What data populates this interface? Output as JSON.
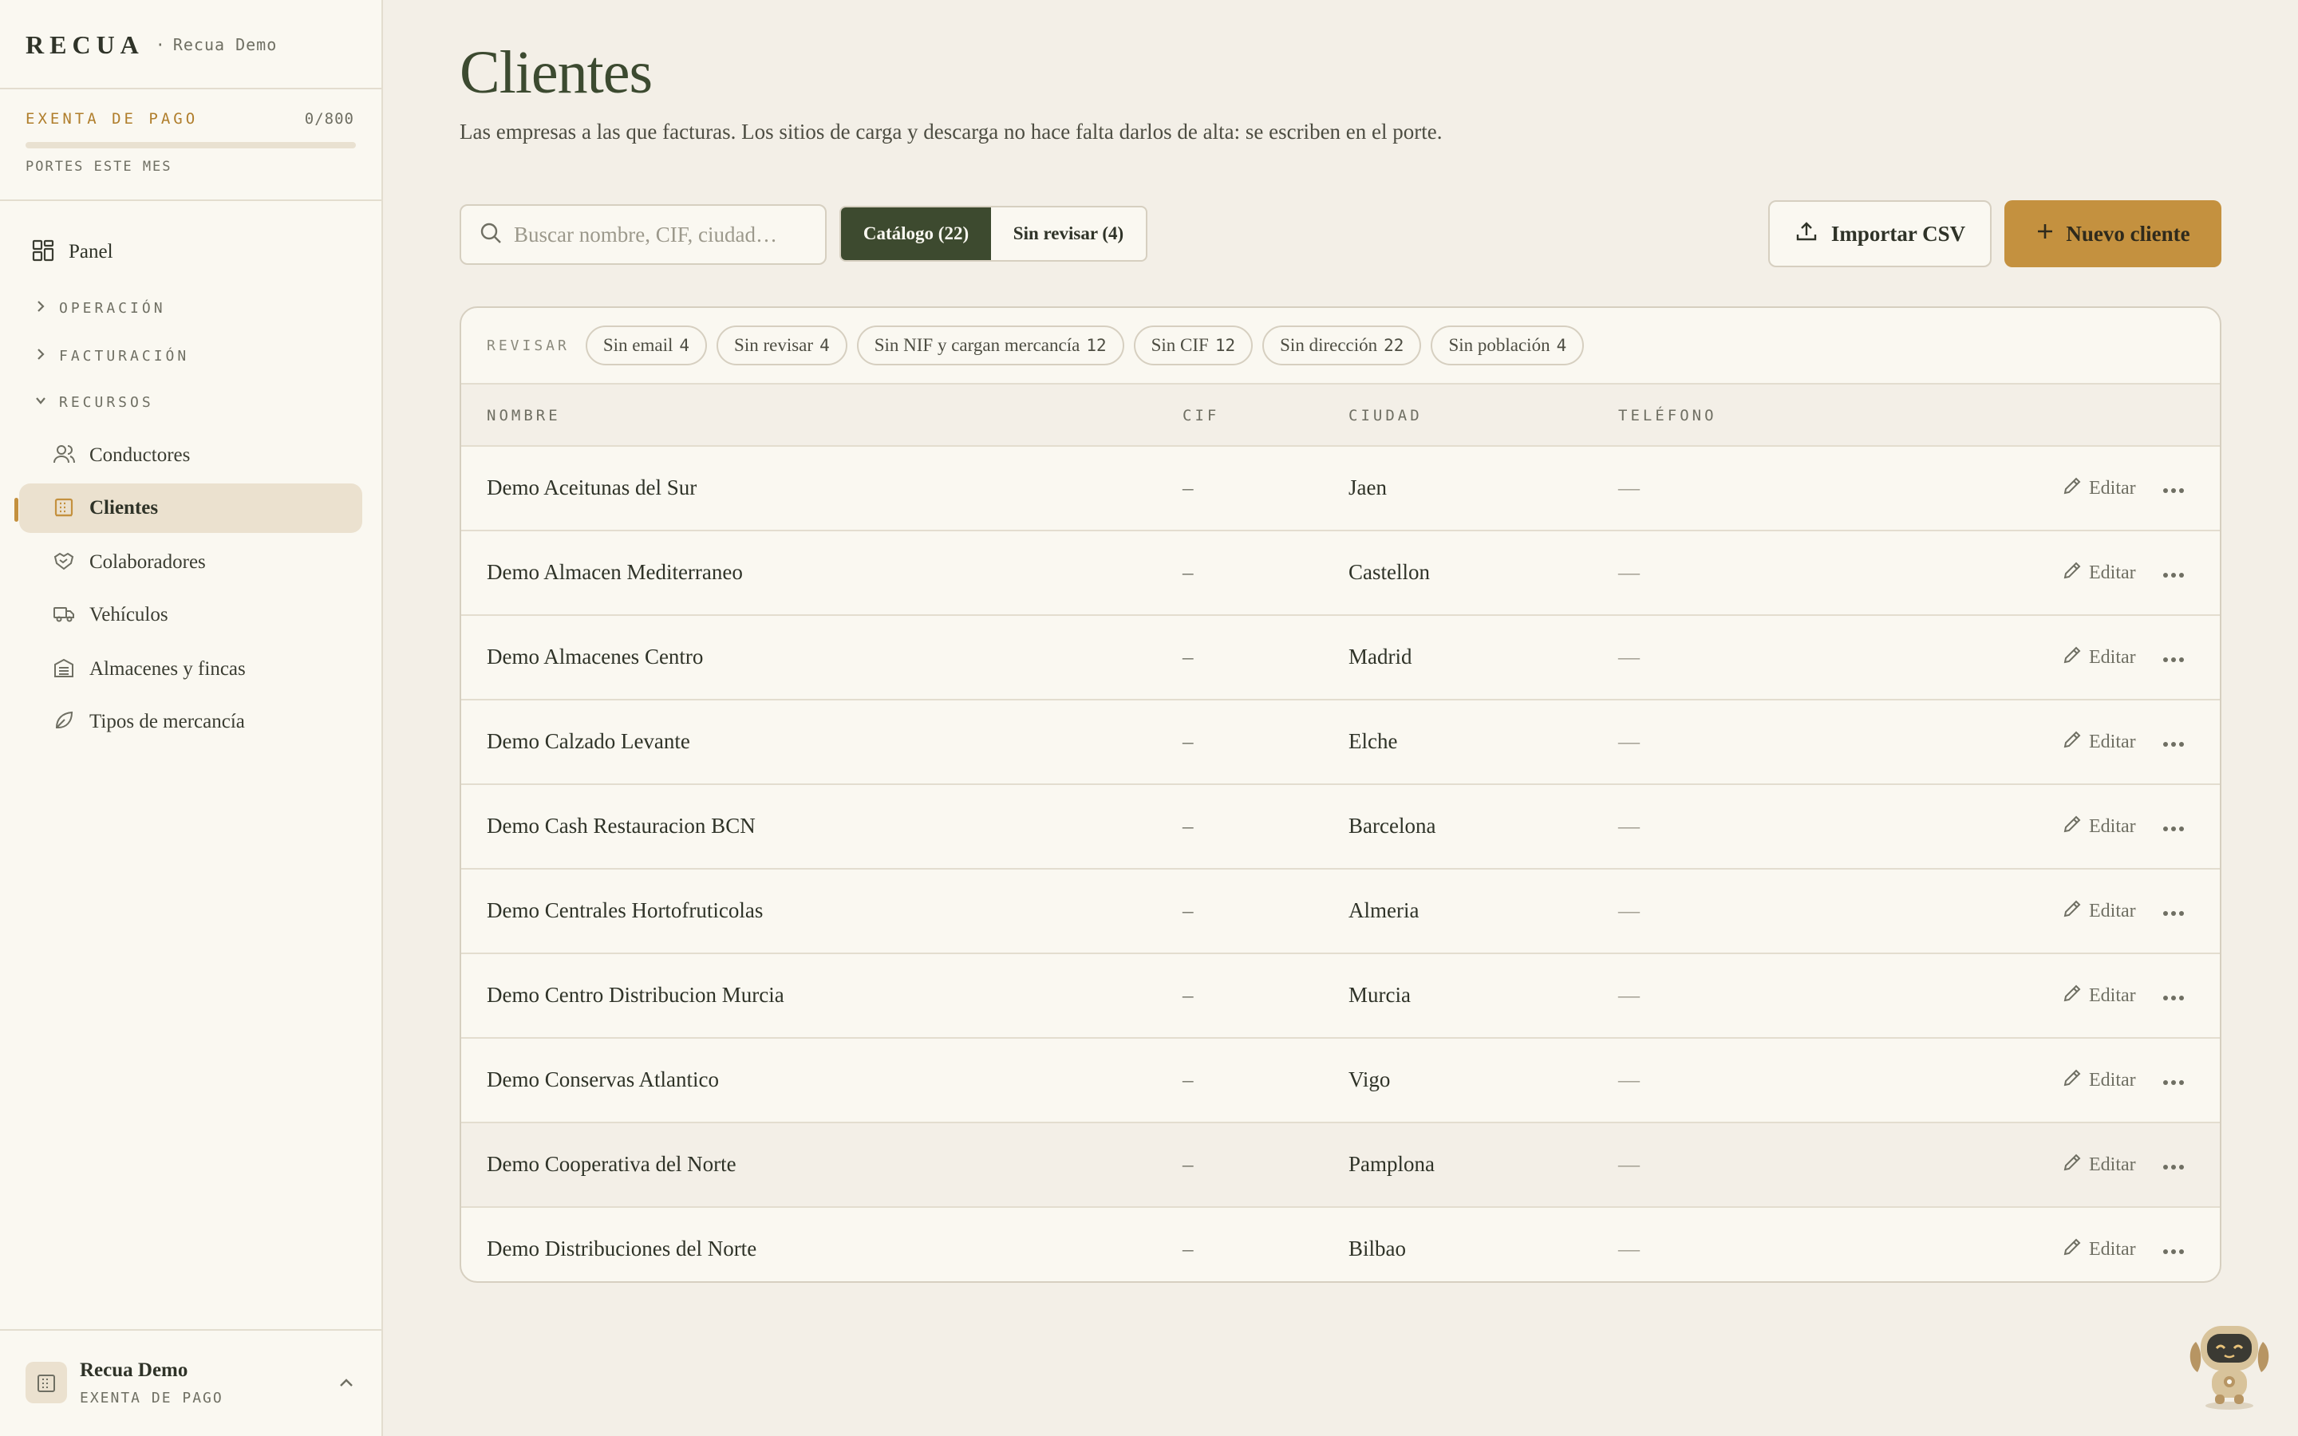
{
  "app": {
    "brand": "RECUA",
    "separator": "·",
    "org": "Recua Demo"
  },
  "quota": {
    "label": "EXENTA DE PAGO",
    "count": "0/800",
    "used": 0,
    "limit": 800,
    "sub": "PORTES ESTE MES"
  },
  "nav": {
    "panel": "Panel",
    "sections": {
      "operacion": "OPERACIÓN",
      "facturacion": "FACTURACIÓN",
      "recursos": "RECURSOS"
    },
    "items": [
      {
        "label": "Conductores",
        "icon": "users-icon"
      },
      {
        "label": "Clientes",
        "icon": "building-icon",
        "active": true
      },
      {
        "label": "Colaboradores",
        "icon": "handshake-icon"
      },
      {
        "label": "Vehículos",
        "icon": "truck-icon"
      },
      {
        "label": "Almacenes y fincas",
        "icon": "warehouse-icon"
      },
      {
        "label": "Tipos de mercancía",
        "icon": "leaf-icon"
      }
    ]
  },
  "footer": {
    "name": "Recua Demo",
    "plan": "EXENTA DE PAGO"
  },
  "page": {
    "title": "Clientes",
    "description": "Las empresas a las que facturas. Los sitios de carga y descarga no hace falta darlos de alta: se escriben en el porte."
  },
  "toolbar": {
    "search_placeholder": "Buscar nombre, CIF, ciudad…",
    "tab_catalog": "Catálogo (22)",
    "tab_unreviewed": "Sin revisar (4)",
    "import_label": "Importar CSV",
    "new_label": "Nuevo cliente"
  },
  "review": {
    "label": "REVISAR",
    "chips": [
      {
        "label": "Sin email",
        "count": "4"
      },
      {
        "label": "Sin revisar",
        "count": "4"
      },
      {
        "label": "Sin NIF y cargan mercancía",
        "count": "12"
      },
      {
        "label": "Sin CIF",
        "count": "12"
      },
      {
        "label": "Sin dirección",
        "count": "22"
      },
      {
        "label": "Sin población",
        "count": "4"
      }
    ]
  },
  "table": {
    "headers": {
      "name": "NOMBRE",
      "cif": "CIF",
      "city": "CIUDAD",
      "phone": "TELÉFONO"
    },
    "edit_label": "Editar",
    "rows": [
      {
        "name": "Demo Aceitunas del Sur",
        "cif": "–",
        "city": "Jaen",
        "phone": "—"
      },
      {
        "name": "Demo Almacen Mediterraneo",
        "cif": "–",
        "city": "Castellon",
        "phone": "—"
      },
      {
        "name": "Demo Almacenes Centro",
        "cif": "–",
        "city": "Madrid",
        "phone": "—"
      },
      {
        "name": "Demo Calzado Levante",
        "cif": "–",
        "city": "Elche",
        "phone": "—"
      },
      {
        "name": "Demo Cash Restauracion BCN",
        "cif": "–",
        "city": "Barcelona",
        "phone": "—"
      },
      {
        "name": "Demo Centrales Hortofruticolas",
        "cif": "–",
        "city": "Almeria",
        "phone": "—"
      },
      {
        "name": "Demo Centro Distribucion Murcia",
        "cif": "–",
        "city": "Murcia",
        "phone": "—"
      },
      {
        "name": "Demo Conservas Atlantico",
        "cif": "–",
        "city": "Vigo",
        "phone": "—"
      },
      {
        "name": "Demo Cooperativa del Norte",
        "cif": "–",
        "city": "Pamplona",
        "phone": "—",
        "hovered": true
      },
      {
        "name": "Demo Distribuciones del Norte",
        "cif": "–",
        "city": "Bilbao",
        "phone": "—"
      }
    ]
  },
  "colors": {
    "accent": "#c4913f",
    "dark_green": "#3d4a2f",
    "background": "#f3efe7",
    "surface": "#faf8f1",
    "border": "#d6cfc0"
  }
}
